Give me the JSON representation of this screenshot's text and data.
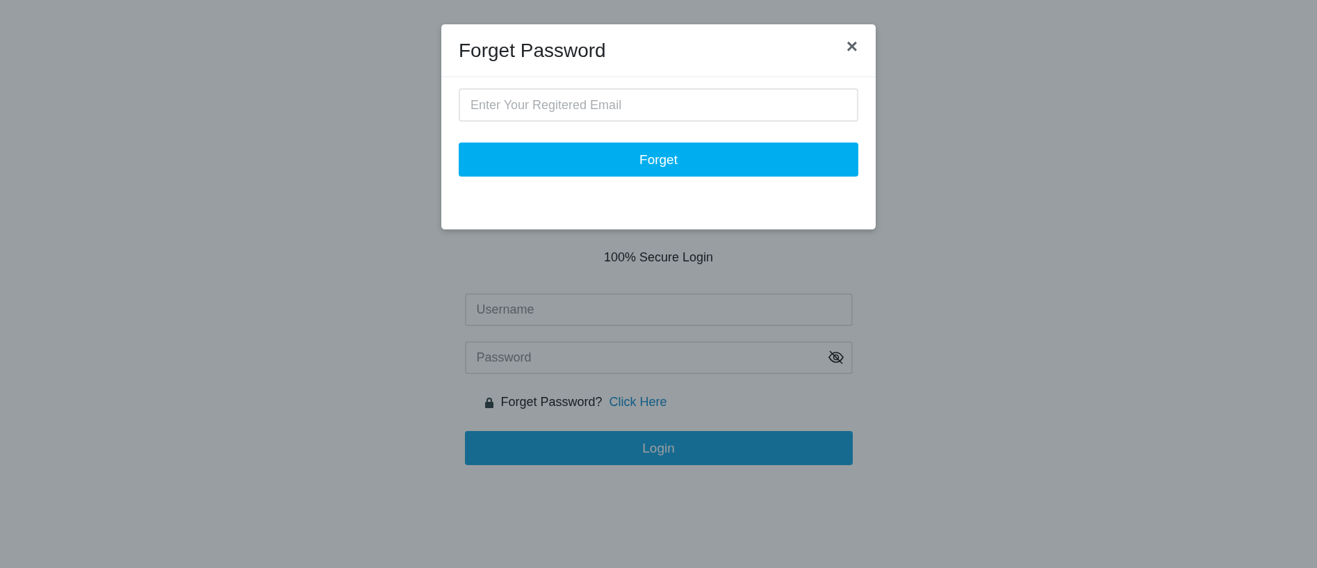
{
  "login": {
    "subtitle": "100% Secure Login",
    "fields": [
      {
        "kind": "text",
        "placeholder": "Username"
      },
      {
        "kind": "password",
        "placeholder": "Password"
      }
    ],
    "forgot": {
      "text": "Forget Password?",
      "link": "Click Here"
    },
    "button": "Login"
  },
  "modal": {
    "title": "Forget Password",
    "close": "×",
    "email_placeholder": "Enter Your Regitered Email",
    "button": "Forget"
  }
}
